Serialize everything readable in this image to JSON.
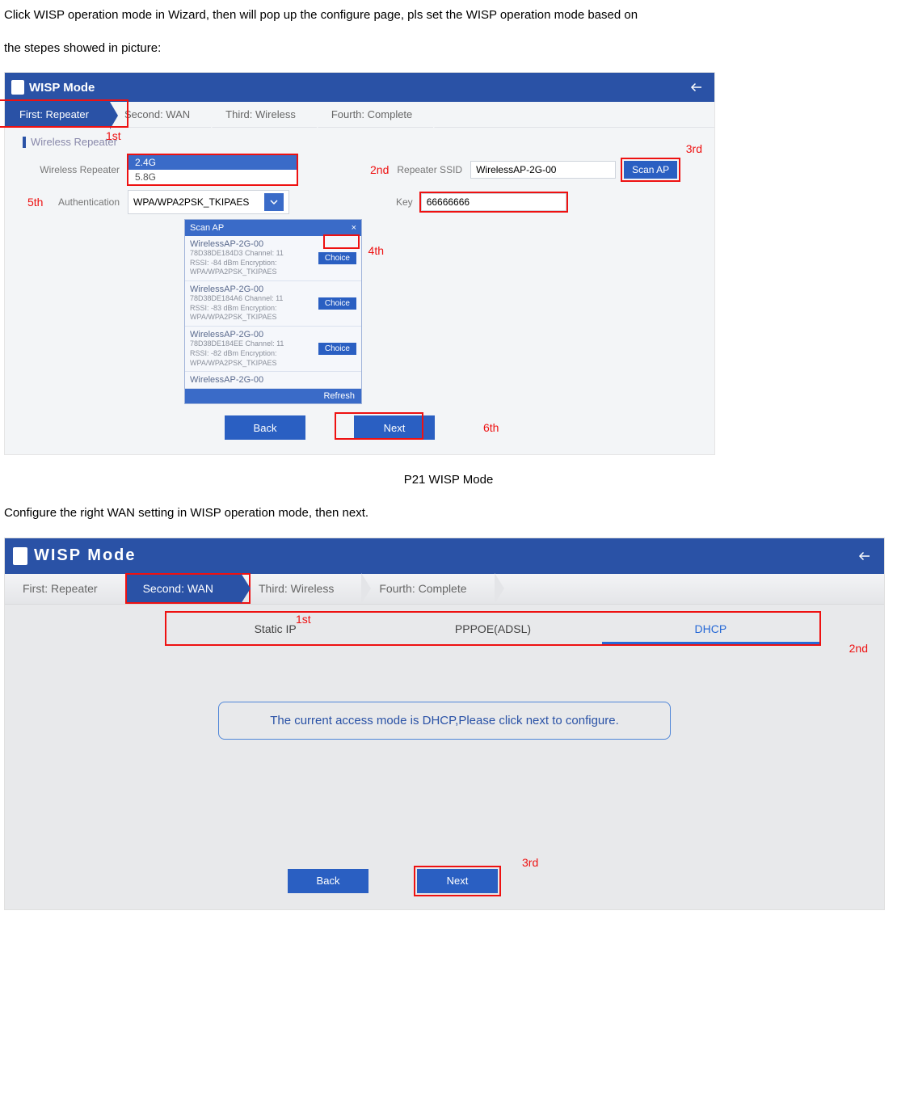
{
  "doc": {
    "intro_line": "Click WISP operation mode in Wizard, then will pop up the configure page, pls set the WISP operation mode based on",
    "intro_line2": "the stepes showed in picture:",
    "caption1": "P21 WISP Mode",
    "wan_instr": "Configure the right WAN setting in WISP operation mode, then next."
  },
  "fig1": {
    "title": "WISP Mode",
    "steps": [
      "First: Repeater",
      "Second: WAN",
      "Third: Wireless",
      "Fourth: Complete"
    ],
    "anno": {
      "s1": "1st",
      "s2": "2nd",
      "s3": "3rd",
      "s4": "4th",
      "s5": "5th",
      "s6": "6th"
    },
    "section": "Wireless Repeater",
    "labels": {
      "wireless_repeater": "Wireless Repeater",
      "authentication": "Authentication",
      "repeater_ssid": "Repeater SSID",
      "key": "Key"
    },
    "band_selected": "2.4G",
    "band_other": "5.8G",
    "auth_value": "WPA/WPA2PSK_TKIPAES",
    "ssid_value": "WirelessAP-2G-00",
    "key_value": "66666666",
    "scan_btn": "Scan AP",
    "scan_panel": {
      "header": "Scan AP",
      "choice": "Choice",
      "refresh": "Refresh",
      "items": [
        {
          "ssid": "WirelessAP-2G-00",
          "mac": "78D38DE184D3",
          "channel": "Channel: 11",
          "rssi": "RSSI: -84 dBm",
          "enc": "Encryption: WPA/WPA2PSK_TKIPAES"
        },
        {
          "ssid": "WirelessAP-2G-00",
          "mac": "78D38DE184A6",
          "channel": "Channel: 11",
          "rssi": "RSSI: -83 dBm",
          "enc": "Encryption: WPA/WPA2PSK_TKIPAES"
        },
        {
          "ssid": "WirelessAP-2G-00",
          "mac": "78D38DE184EE",
          "channel": "Channel: 11",
          "rssi": "RSSI: -82 dBm",
          "enc": "Encryption: WPA/WPA2PSK_TKIPAES"
        },
        {
          "ssid": "WirelessAP-2G-00",
          "mac": "",
          "channel": "",
          "rssi": "",
          "enc": ""
        }
      ]
    },
    "back": "Back",
    "next": "Next"
  },
  "fig2": {
    "title": "WISP Mode",
    "steps": [
      "First: Repeater",
      "Second: WAN",
      "Third: Wireless",
      "Fourth: Complete"
    ],
    "anno": {
      "s1": "1st",
      "s2": "2nd",
      "s3": "3rd"
    },
    "wan_tabs": [
      "Static IP",
      "PPPOE(ADSL)",
      "DHCP"
    ],
    "info": "The current access mode is DHCP,Please click next to configure.",
    "back": "Back",
    "next": "Next"
  }
}
